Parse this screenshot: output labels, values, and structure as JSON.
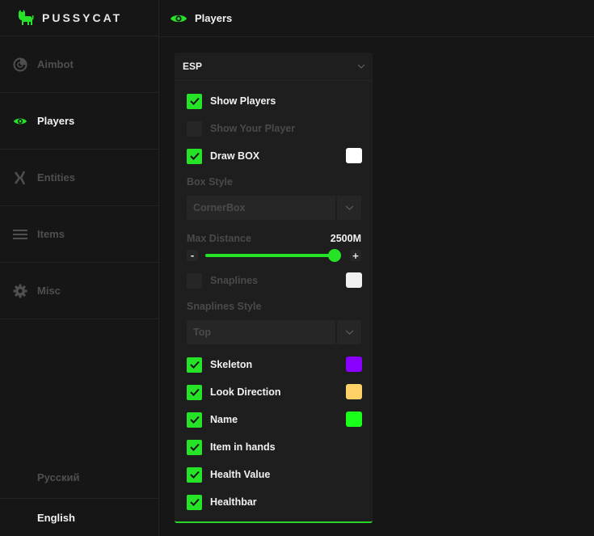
{
  "brand": {
    "name": "PUSSYCAT",
    "accent": "#27e327"
  },
  "sidebar": {
    "items": [
      {
        "label": "Aimbot",
        "icon": "aimbot-icon",
        "active": false
      },
      {
        "label": "Players",
        "icon": "eye-icon",
        "active": true
      },
      {
        "label": "Entities",
        "icon": "entities-icon",
        "active": false
      },
      {
        "label": "Items",
        "icon": "menu-lines-icon",
        "active": false
      },
      {
        "label": "Misc",
        "icon": "gear-icon",
        "active": false
      }
    ],
    "languages": [
      {
        "label": "Русский",
        "active": false
      },
      {
        "label": "English",
        "active": true
      }
    ]
  },
  "header": {
    "title": "Players",
    "icon": "eye-icon"
  },
  "panel": {
    "title": "ESP",
    "options": {
      "show_players": {
        "label": "Show Players",
        "checked": true
      },
      "show_your_player": {
        "label": "Show Your Player",
        "checked": false
      },
      "draw_box": {
        "label": "Draw BOX",
        "checked": true,
        "color": "#ffffff"
      },
      "box_style": {
        "label": "Box Style",
        "value": "CornerBox"
      },
      "max_distance": {
        "label": "Max Distance",
        "value_text": "2500M",
        "fraction": 0.95,
        "minus": "-",
        "plus": "+"
      },
      "snaplines": {
        "label": "Snaplines",
        "checked": false,
        "color": "#f0f0f0"
      },
      "snaplines_style": {
        "label": "Snaplines Style",
        "value": "Top"
      },
      "skeleton": {
        "label": "Skeleton",
        "checked": true,
        "color": "#8a00ff"
      },
      "look_direction": {
        "label": "Look Direction",
        "checked": true,
        "color": "#ffd166"
      },
      "name": {
        "label": "Name",
        "checked": true,
        "color": "#19ff19"
      },
      "item_in_hands": {
        "label": "Item in hands",
        "checked": true
      },
      "health_value": {
        "label": "Health Value",
        "checked": true
      },
      "healthbar": {
        "label": "Healthbar",
        "checked": true
      }
    }
  }
}
